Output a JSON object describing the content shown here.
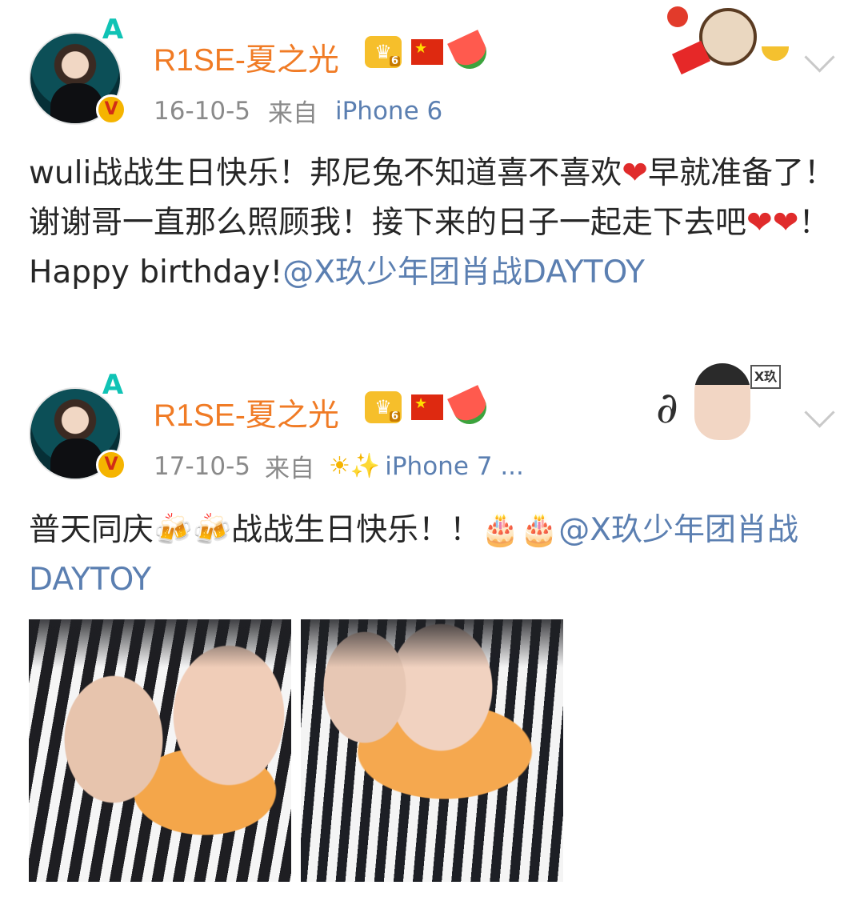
{
  "posts": [
    {
      "author": "R1SE-夏之光",
      "date": "16-10-5",
      "source_prefix": "来自",
      "source": "iPhone 6",
      "text_plain": "wuli战战生日快乐！邦尼兔不知道喜不喜欢",
      "text_after_heart": "早就准备了！谢谢哥一直那么照顾我！接下来的日子一起走下去吧",
      "text_happy": "！Happy birthday!",
      "mention": "@X玖少年团肖战DAYTOY",
      "heart_glyph": "❤"
    },
    {
      "author": "R1SE-夏之光",
      "date": "17-10-5",
      "source_prefix": "来自",
      "sparkle_icons": "☀✨",
      "source": "iPhone 7 ...",
      "text_start": "普天同庆",
      "beer_glyph": "🍻",
      "text_mid": "战战生日快乐！！",
      "cake_glyph": "🎂",
      "mention": "@X玖少年团肖战DAYTOY"
    }
  ],
  "badges": {
    "crown_label": "♛",
    "flag_label": "★",
    "level_label": "A",
    "verified_label": "V",
    "x9_label": "X玖"
  },
  "colors": {
    "author_name": "#f07b25",
    "mention_link": "#5b7fb1",
    "meta_gray": "#8a8a8a"
  }
}
